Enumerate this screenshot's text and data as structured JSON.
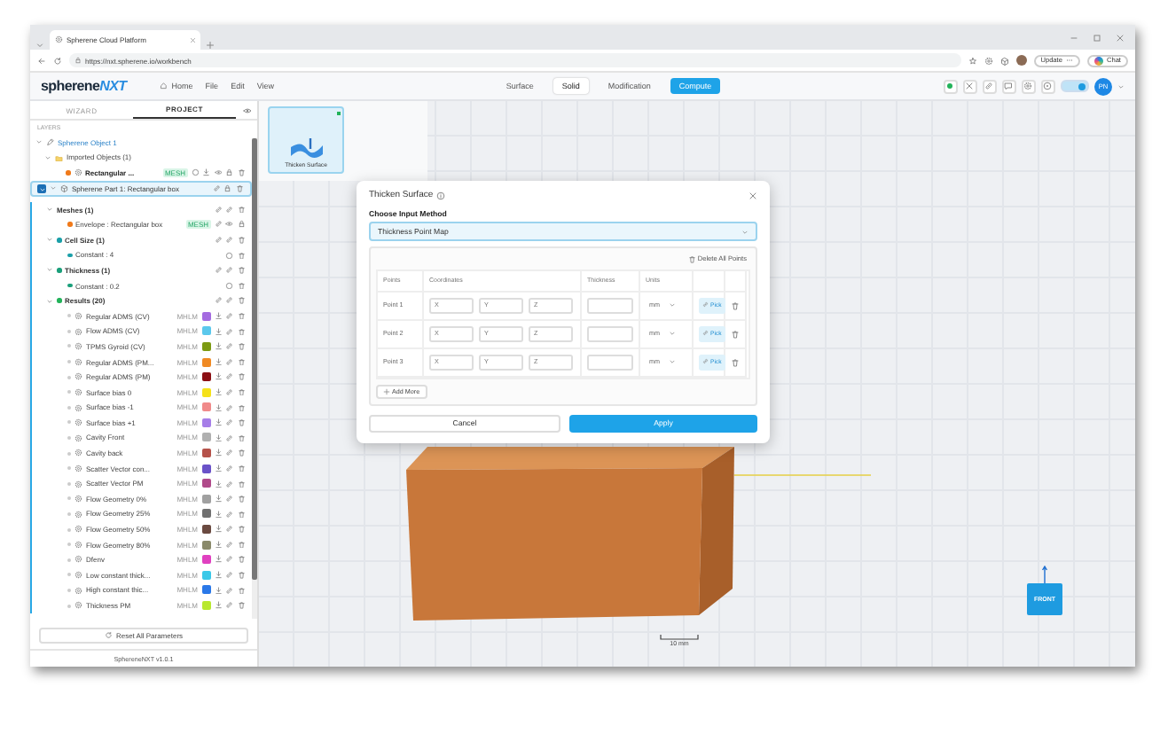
{
  "browser": {
    "tab_title": "Spherene Cloud Platform",
    "url": "https://nxt.spherene.io/workbench",
    "update_label": "Update",
    "chat_label": "Chat"
  },
  "header": {
    "logo": "spherene",
    "logo_accent": "NXT",
    "menu": [
      {
        "label": "Home"
      },
      {
        "label": "File"
      },
      {
        "label": "Edit"
      },
      {
        "label": "View"
      }
    ],
    "modes": [
      {
        "label": "Surface",
        "kind": "tab",
        "selected": false
      },
      {
        "label": "Solid",
        "kind": "tab",
        "selected": true
      },
      {
        "label": "Modification",
        "kind": "tab",
        "selected": false
      },
      {
        "label": "Compute",
        "kind": "action",
        "selected": false
      }
    ],
    "toggle": {
      "on": true
    },
    "avatar": "PN"
  },
  "sidebar": {
    "tabs": [
      {
        "label": "WIZARD",
        "selected": false
      },
      {
        "label": "PROJECT",
        "selected": true
      }
    ],
    "section_label": "LAYERS",
    "tree": [
      {
        "label": "Spherene Object 1",
        "kind": "object",
        "selected": false,
        "expanded": true,
        "children": [
          {
            "label": "Imported Objects (1)",
            "kind": "folder",
            "selected": false,
            "expanded": true,
            "children": [
              {
                "label": "Rectangular ...",
                "kind": "mesh",
                "selected": false,
                "badge": "MESH",
                "color": "#f07a1a"
              }
            ]
          }
        ]
      },
      {
        "label": "Spherene Part 1: Rectangular box",
        "kind": "part",
        "selected": true,
        "checked": true,
        "expanded": true,
        "children": [
          {
            "label": "Meshes (1)",
            "kind": "group",
            "selected": false,
            "expanded": true,
            "children": [
              {
                "label": "Envelope : Rectangular box",
                "kind": "envelope",
                "selected": false,
                "badge": "MESH",
                "color": "#f07a1a"
              }
            ]
          },
          {
            "label": "Cell Size (1)",
            "kind": "group",
            "selected": false,
            "expanded": true,
            "color": "#1a9fa8",
            "children": [
              {
                "label": "Constant : 4",
                "kind": "value",
                "selected": false,
                "color": "#1a9fa8"
              }
            ]
          },
          {
            "label": "Thickness (1)",
            "kind": "group",
            "selected": false,
            "expanded": true,
            "color": "#1a9f7a",
            "children": [
              {
                "label": "Constant : 0.2",
                "kind": "value",
                "selected": false,
                "color": "#1a9f7a"
              }
            ]
          },
          {
            "label": "Results (20)",
            "kind": "group",
            "selected": false,
            "expanded": true,
            "color": "#22b35a",
            "children": [
              {
                "label": "Regular ADMS (CV)",
                "kind": "result",
                "selected": false,
                "tag": "MHLM",
                "color": "#a46be0"
              },
              {
                "label": "Flow ADMS (CV)",
                "kind": "result",
                "selected": false,
                "tag": "MHLM",
                "color": "#5bc8ec"
              },
              {
                "label": "TPMS Gyroid (CV)",
                "kind": "result",
                "selected": false,
                "tag": "MHLM",
                "color": "#7c9a12"
              },
              {
                "label": "Regular ADMS (PM...",
                "kind": "result",
                "selected": false,
                "tag": "MHLM",
                "color": "#f08a24"
              },
              {
                "label": "Regular ADMS (PM)",
                "kind": "result",
                "selected": false,
                "tag": "MHLM",
                "color": "#8b0f14"
              },
              {
                "label": "Surface bias 0",
                "kind": "result",
                "selected": false,
                "tag": "MHLM",
                "color": "#f5e11a"
              },
              {
                "label": "Surface bias -1",
                "kind": "result",
                "selected": false,
                "tag": "MHLM",
                "color": "#f08a8a"
              },
              {
                "label": "Surface bias +1",
                "kind": "result",
                "selected": false,
                "tag": "MHLM",
                "color": "#a67ee8"
              },
              {
                "label": "Cavity Front",
                "kind": "result",
                "selected": false,
                "tag": "MHLM",
                "color": "#b0b0b0"
              },
              {
                "label": "Cavity back",
                "kind": "result",
                "selected": false,
                "tag": "MHLM",
                "color": "#b5524a"
              },
              {
                "label": "Scatter Vector con...",
                "kind": "result",
                "selected": false,
                "tag": "MHLM",
                "color": "#6a52c8"
              },
              {
                "label": "Scatter Vector PM",
                "kind": "result",
                "selected": false,
                "tag": "MHLM",
                "color": "#b04a8a"
              },
              {
                "label": "Flow Geometry 0%",
                "kind": "result",
                "selected": false,
                "tag": "MHLM",
                "color": "#a0a0a0"
              },
              {
                "label": "Flow Geometry 25%",
                "kind": "result",
                "selected": false,
                "tag": "MHLM",
                "color": "#707070"
              },
              {
                "label": "Flow Geometry 50%",
                "kind": "result",
                "selected": false,
                "tag": "MHLM",
                "color": "#6a4a40"
              },
              {
                "label": "Flow Geometry 80%",
                "kind": "result",
                "selected": false,
                "tag": "MHLM",
                "color": "#8a8a6a"
              },
              {
                "label": "Dfenv",
                "kind": "result",
                "selected": false,
                "tag": "MHLM",
                "color": "#e040c0"
              },
              {
                "label": "Low constant thick...",
                "kind": "result",
                "selected": false,
                "tag": "MHLM",
                "color": "#3ac8e8"
              },
              {
                "label": "High constant thic...",
                "kind": "result",
                "selected": false,
                "tag": "MHLM",
                "color": "#2a78e8"
              },
              {
                "label": "Thickness PM",
                "kind": "result",
                "selected": false,
                "tag": "MHLM",
                "color": "#b8e830"
              }
            ]
          }
        ]
      }
    ],
    "reset_button": "Reset All Parameters",
    "version": "SphereneNXT v1.0.1"
  },
  "workspace": {
    "tools": [
      {
        "label": "Thicken Surface",
        "selected": true
      }
    ],
    "scale_label": "10 mm",
    "view_cube_label": "FRONT"
  },
  "dialog": {
    "title": "Thicken Surface",
    "method_label": "Choose Input Method",
    "method_value": "Thickness Point Map",
    "delete_all": "Delete All Points",
    "columns": [
      "Points",
      "Coordinates",
      "Thickness",
      "Units"
    ],
    "rows": [
      {
        "label": "Point 1",
        "placeholders": [
          "X",
          "Y",
          "Z"
        ],
        "unit": "mm",
        "pick": "Pick"
      },
      {
        "label": "Point 2",
        "placeholders": [
          "X",
          "Y",
          "Z"
        ],
        "unit": "mm",
        "pick": "Pick"
      },
      {
        "label": "Point 3",
        "placeholders": [
          "X",
          "Y",
          "Z"
        ],
        "unit": "mm",
        "pick": "Pick"
      }
    ],
    "add_more": "Add More",
    "cancel": "Cancel",
    "apply": "Apply"
  }
}
